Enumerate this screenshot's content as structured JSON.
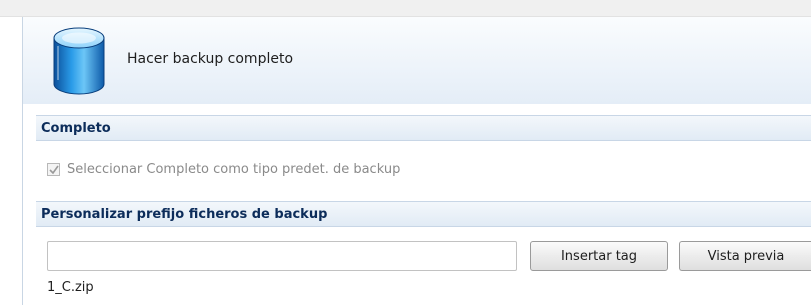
{
  "header": {
    "title": "Hacer backup completo",
    "icon": "database-icon"
  },
  "sections": {
    "full": {
      "title": "Completo",
      "checkbox_label": "Seleccionar Completo como tipo predet. de backup",
      "checkbox_checked": true,
      "checkbox_disabled": true
    },
    "prefix": {
      "title": "Personalizar prefijo ficheros de backup",
      "input_value": "",
      "insert_tag_label": "Insertar tag",
      "preview_label": "Vista previa",
      "preview_result": "1_C.zip"
    }
  },
  "colors": {
    "section_text": "#0c2c5a",
    "section_bg": "#e1ebf5",
    "header_bg": "#eef4fa",
    "icon_blue": "#1f7fd0"
  }
}
